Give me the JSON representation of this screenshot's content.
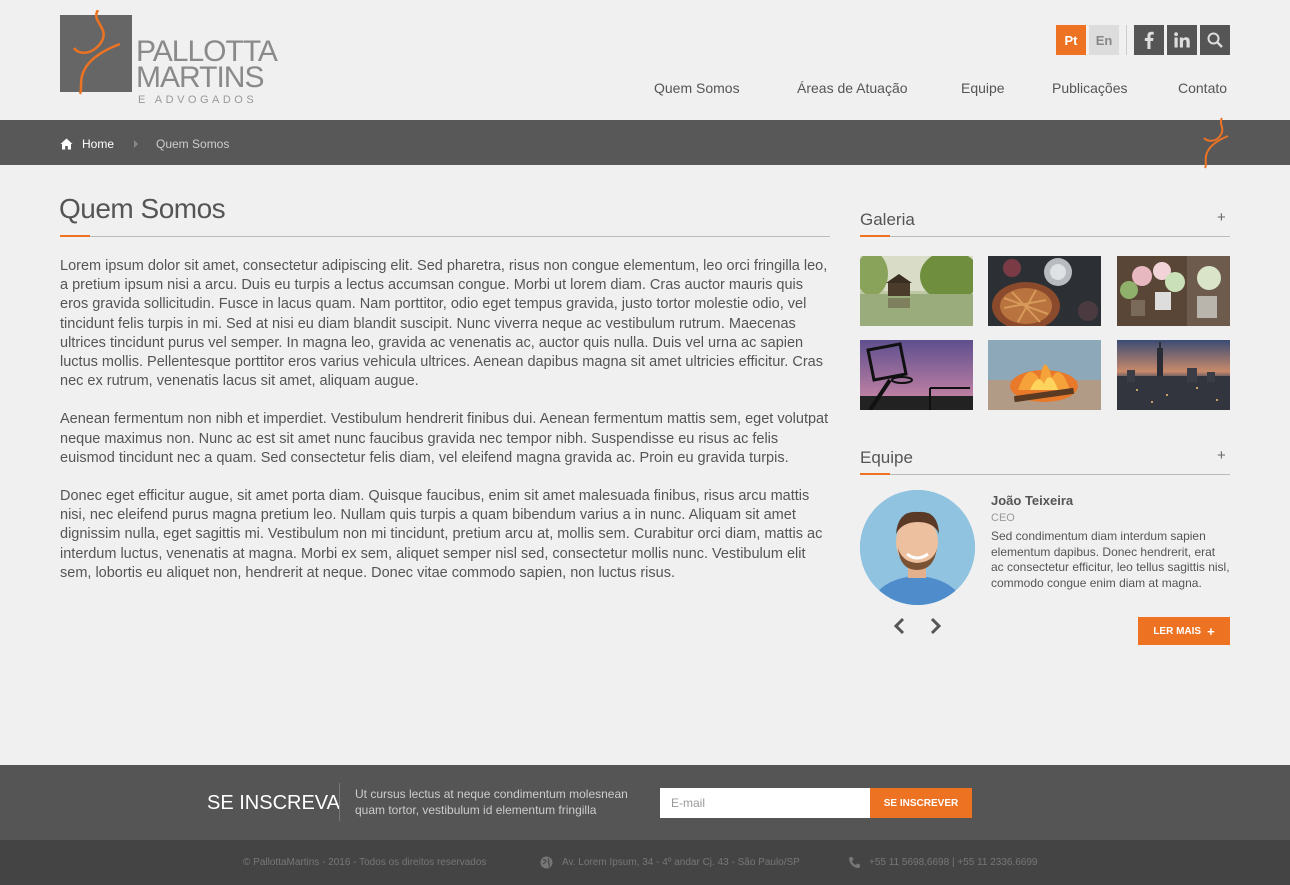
{
  "logo": {
    "line1": "PALLOTTA",
    "line2": "MARTINS",
    "line3": "E ADVOGADOS"
  },
  "header": {
    "lang_pt": "Pt",
    "lang_en": "En",
    "nav": [
      "Quem Somos",
      "Áreas de Atuação",
      "Equipe",
      "Publicações",
      "Contato"
    ]
  },
  "breadcrumb": {
    "home": "Home",
    "current": "Quem Somos"
  },
  "main": {
    "title": "Quem Somos",
    "paragraphs": [
      "Lorem ipsum dolor sit amet, consectetur adipiscing elit. Sed pharetra, risus non congue elementum, leo orci fringilla leo, a pretium ipsum nisi a arcu. Duis eu turpis a lectus accumsan congue. Morbi ut lorem diam. Cras auctor mauris quis eros gravida sollicitudin. Fusce in lacus quam. Nam porttitor, odio eget tempus gravida, justo tortor molestie odio, vel tincidunt felis turpis in mi. Sed at nisi eu diam blandit suscipit. Nunc viverra neque ac vestibulum rutrum. Maecenas ultrices tincidunt purus vel semper. In magna leo, gravida ac venenatis ac, auctor quis nulla. Duis vel urna ac sapien luctus mollis. Pellentesque porttitor eros varius vehicula ultrices. Aenean dapibus magna sit amet ultricies efficitur. Cras nec ex rutrum, venenatis lacus sit amet, aliquam augue.",
      "Aenean fermentum non nibh et imperdiet. Vestibulum hendrerit finibus dui. Aenean fermentum mattis sem, eget volutpat neque maximus non. Nunc ac est sit amet nunc faucibus gravida nec tempor nibh. Suspendisse eu risus ac felis euismod tincidunt nec a quam. Sed consectetur felis diam, vel eleifend magna gravida ac. Proin eu gravida turpis.",
      "Donec eget efficitur augue, sit amet porta diam. Quisque faucibus, enim sit amet malesuada finibus, risus arcu mattis nisi, nec eleifend purus magna pretium leo. Nullam quis turpis a quam bibendum varius a in nunc. Aliquam sit amet dignissim nulla, eget sagittis mi. Vestibulum non mi tincidunt, pretium arcu at, mollis sem. Curabitur orci diam, mattis ac interdum luctus, venenatis at magna. Morbi ex sem, aliquet semper nisl sed, consectetur mollis nunc. Vestibulum elit sem, lobortis eu aliquet non, hendrerit at neque. Donec vitae commodo sapien, non luctus risus."
    ]
  },
  "sidebar": {
    "gallery_title": "Galeria",
    "team_title": "Equipe",
    "plus": "+",
    "member": {
      "name": "João Teixeira",
      "role": "CEO",
      "desc": "Sed condimentum diam interdum sapien elementum dapibus. Donec hendrerit, erat ac consectetur efficitur, leo tellus sagittis nisl, commodo congue enim diam at magna."
    },
    "read_more": "LER MAIS",
    "read_more_plus": "+"
  },
  "newsletter": {
    "title": "SE INSCREVA",
    "desc": "Ut cursus lectus at neque condimentum molesnean quam tortor, vestibulum id elementum fringilla",
    "placeholder": "E-mail",
    "button": "SE INSCREVER"
  },
  "footer": {
    "copyright": "© PallottaMartins - 2016 - Todos os direitos reservados",
    "address": "Av. Lorem Ipsum, 34 - 4º andar Cj. 43 - São Paulo/SP",
    "phone": "+55 11 5698.6698 | +55 11 2336.6699"
  },
  "colors": {
    "accent": "#ed7323",
    "dark_bar": "#585859",
    "footer": "#444445"
  }
}
